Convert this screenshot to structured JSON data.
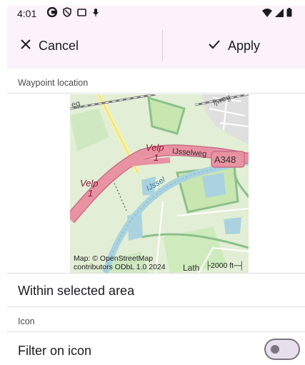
{
  "status_bar": {
    "time": "4:01",
    "icons_left": [
      "google-g-icon",
      "shield-icon",
      "tablet-icon",
      "mic-icon"
    ],
    "icons_right": [
      "wifi-icon",
      "signal-icon",
      "battery-icon"
    ]
  },
  "top_bar": {
    "cancel_label": "Cancel",
    "apply_label": "Apply"
  },
  "location_section": {
    "label": "Waypoint location",
    "map": {
      "labels": {
        "road_top": "ijweg",
        "road_top_left": "eg",
        "velp_1": "Velp",
        "velp_1_num": "1",
        "velp_2": "Velp",
        "velp_2_num": "1",
        "ijsselweg": "IJsselweg",
        "a348": "A348",
        "ijssel": "IJssel",
        "town": "Lath"
      },
      "attribution": "Map: © OpenStreetMap contributors ODbL 1.0 2024",
      "scale": "2000 ft"
    },
    "within_area": "Within selected area"
  },
  "icon_section": {
    "label": "Icon",
    "filter_label": "Filter on icon",
    "filter_enabled": false
  },
  "colors": {
    "bar_bg": "#fbf2fb",
    "text": "#1c1b1f",
    "motorway": "#e892a2",
    "river": "#aad3df",
    "park": "#c8e6b0"
  }
}
